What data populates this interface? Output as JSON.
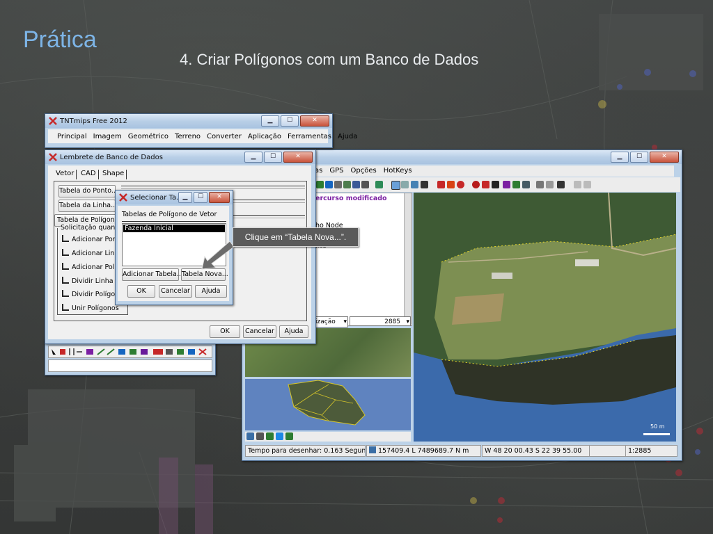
{
  "slide": {
    "title": "Prática",
    "subtitle": "4. Criar Polígonos com um Banco de Dados"
  },
  "main_window": {
    "title": "TNTmips Free 2012",
    "menu": [
      "Principal",
      "Imagem",
      "Geométrico",
      "Terreno",
      "Converter",
      "Aplicação",
      "Ferramentas",
      "Ajuda"
    ]
  },
  "map_window": {
    "menu": [
      "as",
      "GPS",
      "Opções",
      "HotKeys"
    ],
    "info_lines": [
      "ercurso modificado",
      "ho Node",
      "nte"
    ],
    "layer_dropdown": "ização",
    "scale_value": "2885",
    "scale_bar": "50 m",
    "status": {
      "draw_time": "Tempo para desenhar: 0.163 Segundos",
      "coords": "157409.4 L  7489689.7 N m",
      "latlon": "W 48 20 00.43  S 22 39 55.00",
      "scale": "1:2885"
    }
  },
  "reminder_window": {
    "title": "Lembrete de Banco de Dados",
    "tabs": [
      "Vetor",
      "CAD",
      "Shape"
    ],
    "table_buttons": [
      "Tabela do Ponto...",
      "Tabela da Linha...",
      "Tabela de Polígono"
    ],
    "group_label": "Solicitação quand",
    "options": [
      "Adicionar Ponto",
      "Adicionar Linha",
      "Adicionar Polígo",
      "Dividir Linha",
      "Dividir Polígono",
      "Unir Polígonos"
    ],
    "ok": "OK",
    "cancel": "Cancelar",
    "help": "Ajuda"
  },
  "select_dialog": {
    "title": "Selecionar Ta...",
    "label": "Tabelas de Polígono de Vetor",
    "items": [
      "Fazenda Inicial"
    ],
    "add_table": "Adicionar Tabela...",
    "new_table": "Tabela Nova...",
    "ok": "OK",
    "cancel": "Cancelar",
    "help": "Ajuda"
  },
  "callout": {
    "text": "Clique em “Tabela Nova...”."
  },
  "colors": {
    "title_accent": "#7db4e6",
    "window_frame": "#bcd2e8",
    "callout_bg": "#5b5b5b",
    "selection": "#000000"
  },
  "icons": [
    "tntmips-logo-icon",
    "minimize-icon",
    "maximize-icon",
    "close-icon",
    "pointer-arrow-icon",
    "dropdown-arrow-icon",
    "zoom-icon",
    "edit-tools-icon"
  ]
}
